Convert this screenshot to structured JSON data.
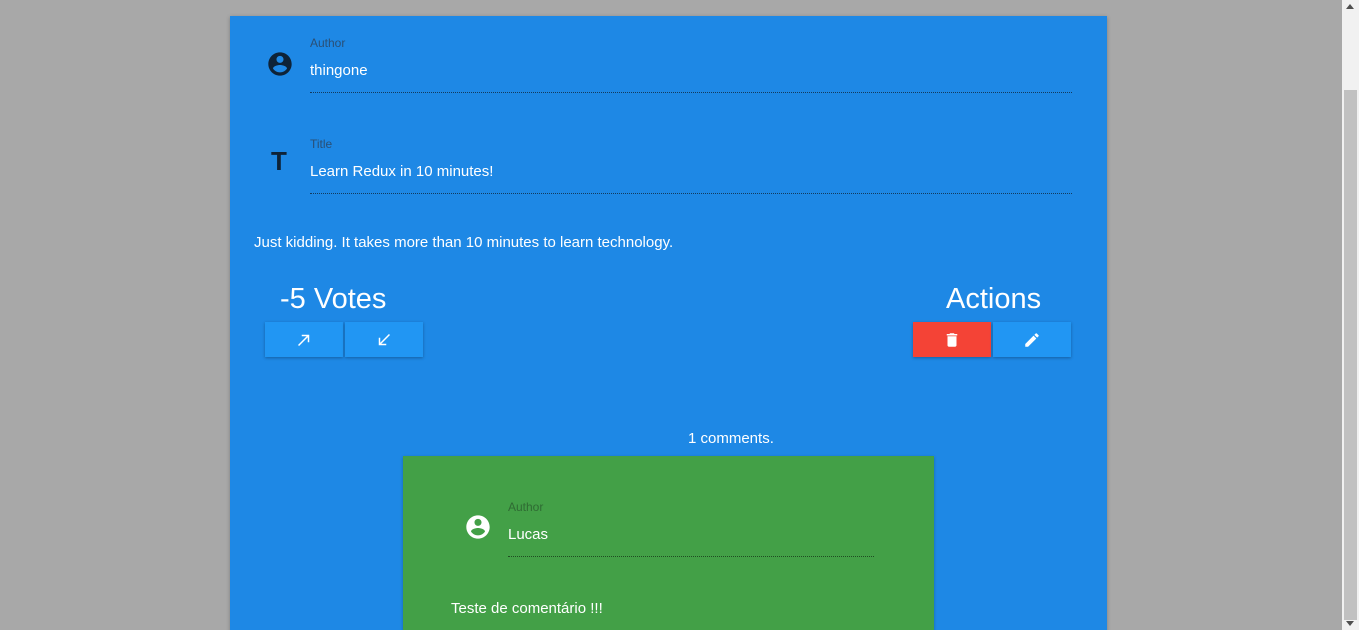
{
  "post": {
    "author_label": "Author",
    "author_value": "thingone",
    "title_label": "Title",
    "title_value": "Learn Redux in 10 minutes!",
    "title_icon_glyph": "T",
    "body": "Just kidding. It takes more than 10 minutes to learn technology.",
    "votes_heading": "-5 Votes",
    "actions_heading": "Actions"
  },
  "icons": {
    "author": "account-circle-icon",
    "title": "title-icon",
    "upvote": "arrow-up-right-icon",
    "downvote": "arrow-down-left-icon",
    "delete": "trash-icon",
    "edit": "pencil-icon"
  },
  "comments": {
    "count_text": "1 comments.",
    "items": [
      {
        "author_label": "Author",
        "author_value": "Lucas",
        "body": "Teste de comentário !!!"
      }
    ]
  },
  "colors": {
    "page_background": "#a8a8a8",
    "post_card": "#1e88e5",
    "vote_button": "#2196f3",
    "delete_button": "#f44336",
    "comment_card": "#43a047"
  }
}
